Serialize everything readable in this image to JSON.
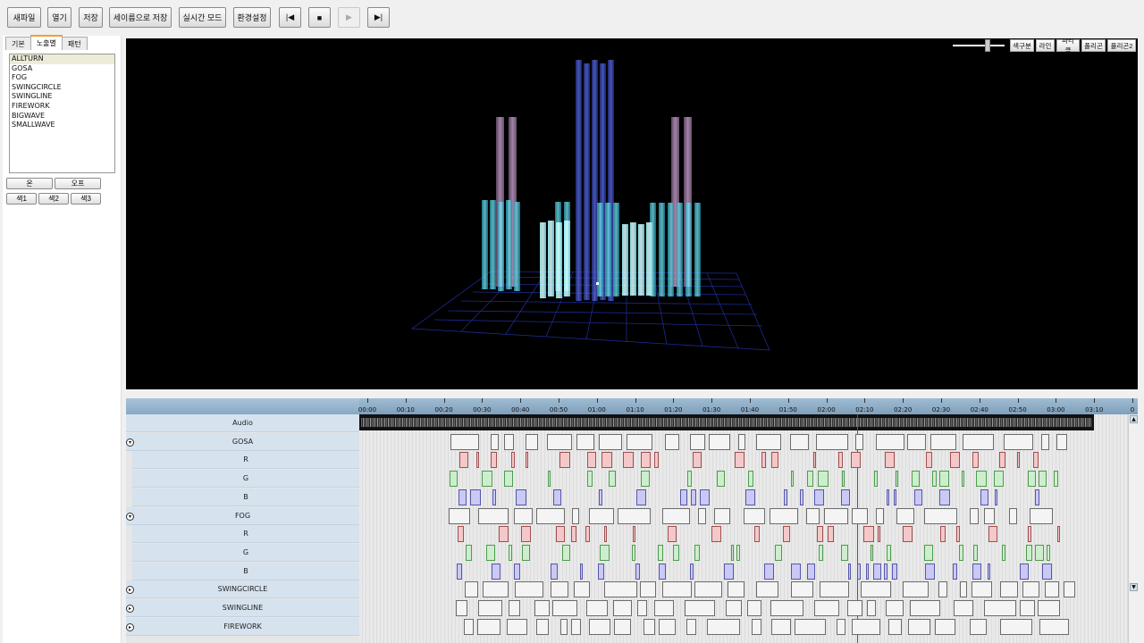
{
  "toolbar": {
    "new_file": "새파일",
    "open": "열기",
    "save": "저장",
    "save_as": "세이름으로 저장",
    "realtime_mode": "실시간 모드",
    "settings": "환경설정",
    "media_icons": [
      "skip-to-start-icon",
      "stop-icon",
      "play-icon",
      "skip-to-end-icon"
    ]
  },
  "left_panel": {
    "tabs": [
      "기본",
      "노출별",
      "패턴"
    ],
    "active_tab": 1,
    "effects": [
      "ALLTURN",
      "GOSA",
      "FOG",
      "SWINGCIRCLE",
      "SWINGLINE",
      "FIREWORK",
      "BIGWAVE",
      "SMALLWAVE"
    ],
    "selected_effect": 0,
    "on_label": "온",
    "off_label": "오프",
    "color1": "색1",
    "color2": "색2",
    "color3": "색3"
  },
  "viewport": {
    "buttons": [
      "색구분",
      "라인",
      "파티클",
      "폴리곤",
      "폴리곤2"
    ]
  },
  "timeline": {
    "ruler_labels": [
      "00:00",
      "00:10",
      "00:20",
      "00:30",
      "00:40",
      "00:50",
      "01:00",
      "01:10",
      "01:20",
      "01:30",
      "01:40",
      "01:50",
      "02:00",
      "02:10",
      "02:20",
      "02:30",
      "02:40",
      "02:50",
      "03:00",
      "03:10",
      "0"
    ],
    "tracks": [
      {
        "label": "Audio",
        "type": "audio",
        "group": true,
        "expander": ""
      },
      {
        "label": "GOSA",
        "type": "white",
        "group": true,
        "expander": "▾"
      },
      {
        "label": "R",
        "type": "red",
        "group": false
      },
      {
        "label": "G",
        "type": "green",
        "group": false
      },
      {
        "label": "B",
        "type": "blue",
        "group": false
      },
      {
        "label": "FOG",
        "type": "white",
        "group": true,
        "expander": "▾"
      },
      {
        "label": "R",
        "type": "red",
        "group": false
      },
      {
        "label": "G",
        "type": "green",
        "group": false
      },
      {
        "label": "B",
        "type": "blue",
        "group": false
      },
      {
        "label": "SWINGCIRCLE",
        "type": "white",
        "group": true,
        "expander": "▸"
      },
      {
        "label": "SWINGLINE",
        "type": "white",
        "group": true,
        "expander": "▸"
      },
      {
        "label": "FIREWORK",
        "type": "white",
        "group": true,
        "expander": "▸"
      }
    ],
    "playhead_time_seconds": 128
  },
  "colors": {
    "viewport_bg": "#000000",
    "clip_red": "#f4c8c8",
    "clip_green": "#cdeecd",
    "clip_blue": "#c9c9f4",
    "playhead": "#e02020"
  }
}
